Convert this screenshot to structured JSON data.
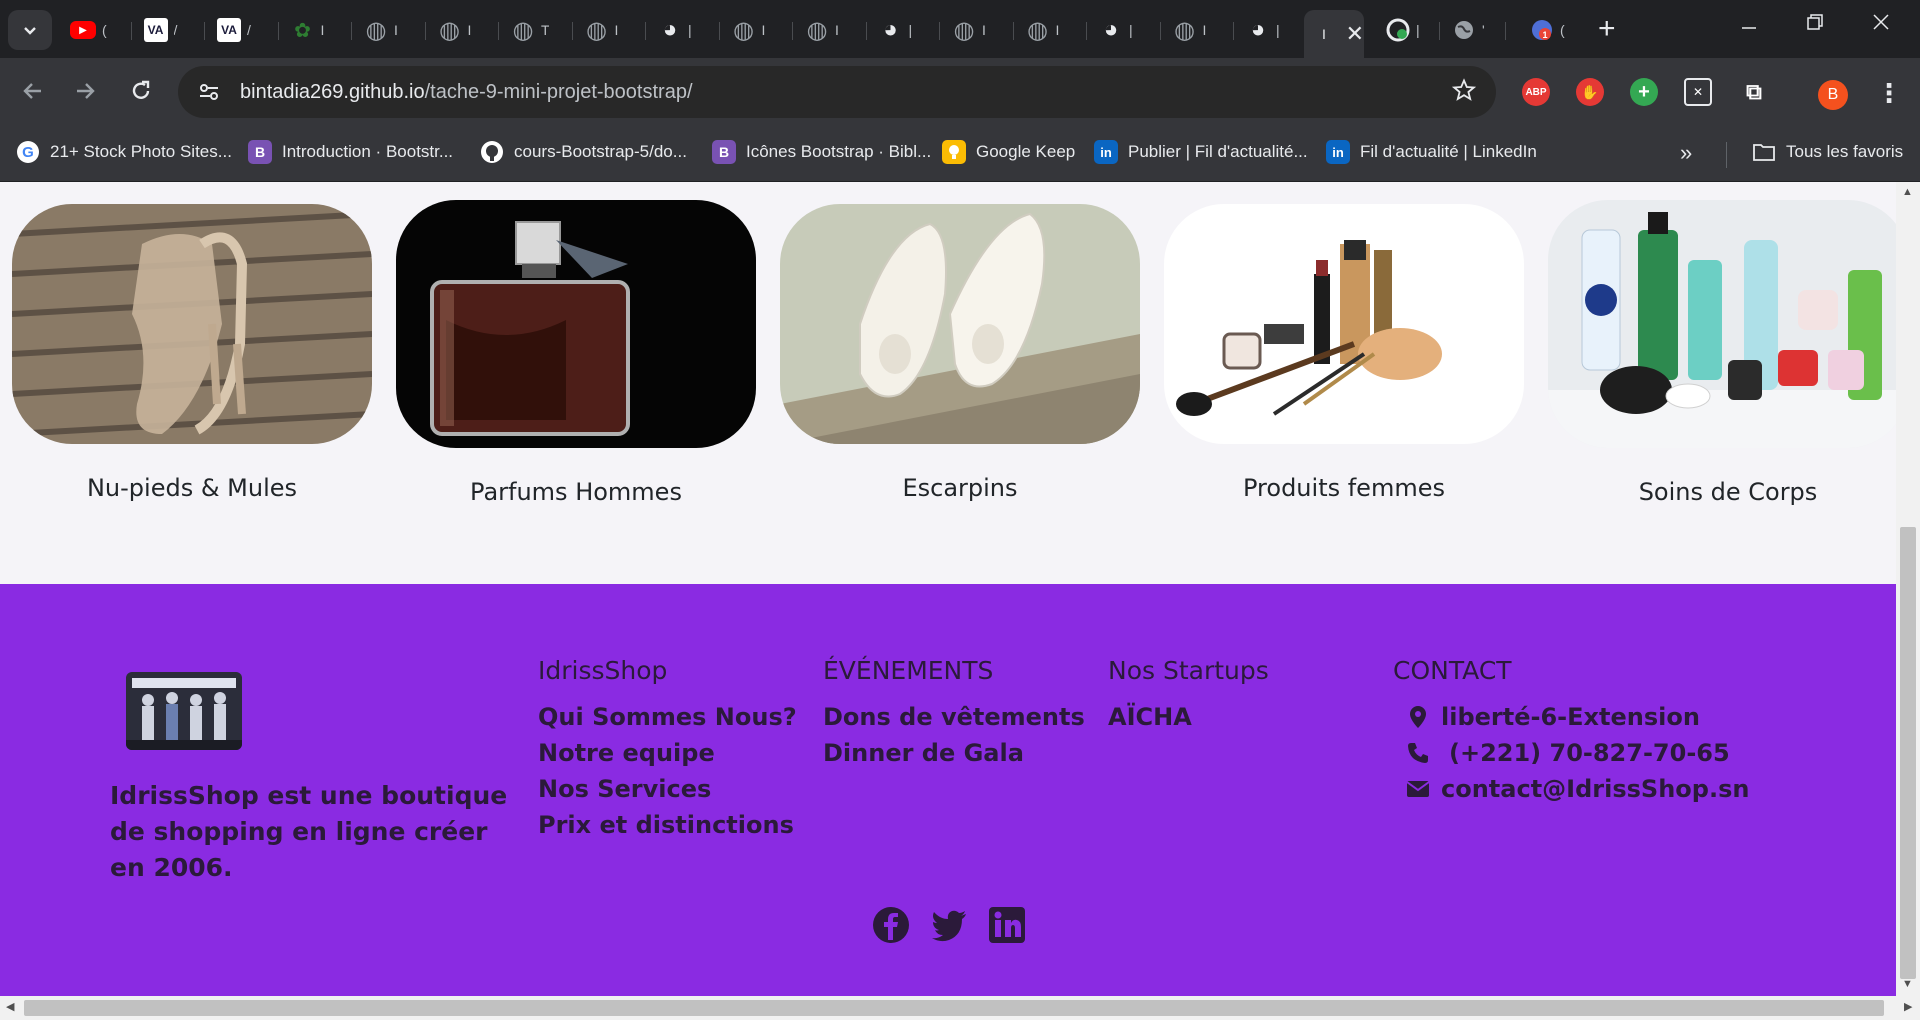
{
  "browser": {
    "active_tab_close": "✕",
    "new_tab": "+",
    "tabs": [
      {
        "icon": "youtube-icon",
        "color": "#ff0000",
        "glyph": "▶",
        "title": "("
      },
      {
        "icon": "va-icon",
        "color": "#1b1b3a",
        "glyph": "VA",
        "title": "/"
      },
      {
        "icon": "va-icon",
        "color": "#1b1b3a",
        "glyph": "VA",
        "title": "/"
      },
      {
        "icon": "leaf-icon",
        "color": "#2e7d32",
        "glyph": "✿",
        "title": "I"
      },
      {
        "icon": "globe-icon",
        "color": "#9aa0a6",
        "glyph": "◍",
        "title": "I"
      },
      {
        "icon": "globe-icon",
        "color": "#9aa0a6",
        "glyph": "◍",
        "title": "I"
      },
      {
        "icon": "globe-icon",
        "color": "#9aa0a6",
        "glyph": "◍",
        "title": "T"
      },
      {
        "icon": "globe-icon",
        "color": "#9aa0a6",
        "glyph": "◍",
        "title": "I"
      },
      {
        "icon": "github-check-icon",
        "color": "#e8eaed",
        "glyph": "◕",
        "title": "|"
      },
      {
        "icon": "globe-icon",
        "color": "#9aa0a6",
        "glyph": "◍",
        "title": "I"
      },
      {
        "icon": "globe-icon",
        "color": "#9aa0a6",
        "glyph": "◍",
        "title": "I"
      },
      {
        "icon": "github-check-icon",
        "color": "#e8eaed",
        "glyph": "◕",
        "title": "|"
      },
      {
        "icon": "globe-icon",
        "color": "#9aa0a6",
        "glyph": "◍",
        "title": "I"
      },
      {
        "icon": "globe-icon",
        "color": "#9aa0a6",
        "glyph": "◍",
        "title": "I"
      },
      {
        "icon": "github-check-icon",
        "color": "#e8eaed",
        "glyph": "◕",
        "title": "|"
      },
      {
        "icon": "globe-icon",
        "color": "#9aa0a6",
        "glyph": "◍",
        "title": "I"
      },
      {
        "icon": "github-check-icon",
        "color": "#e8eaed",
        "glyph": "◕",
        "title": "|"
      }
    ],
    "url_host": "bintadia269.github.io",
    "url_path": "/tache-9-mini-projet-bootstrap/",
    "profile_initial": "B",
    "extensions": [
      "ABP",
      "✋",
      "+",
      "✕",
      "⧉"
    ],
    "bookmarks": [
      {
        "icon": "google-icon",
        "color": "#ffffff",
        "label": "21+ Stock Photo Sites..."
      },
      {
        "icon": "bootstrap-icon",
        "color": "#7952b3",
        "label": "Introduction · Bootstr..."
      },
      {
        "icon": "github-icon",
        "color": "#ffffff",
        "label": "cours-Bootstrap-5/do..."
      },
      {
        "icon": "bootstrap-icon",
        "color": "#7952b3",
        "label": "Icônes Bootstrap · Bibl..."
      },
      {
        "icon": "keep-icon",
        "color": "#fbbc04",
        "label": "Google Keep"
      },
      {
        "icon": "linkedin-icon",
        "color": "#0a66c2",
        "label": "Publier | Fil d'actualité..."
      },
      {
        "icon": "linkedin-icon",
        "color": "#0a66c2",
        "label": "Fil d'actualité | LinkedIn"
      }
    ],
    "bookmarks_overflow": "»",
    "all_bookmarks": "Tous les favoris"
  },
  "categories": [
    {
      "label": "Nu-pieds & Mules"
    },
    {
      "label": "Parfums Hommes"
    },
    {
      "label": "Escarpins"
    },
    {
      "label": "Produits femmes"
    },
    {
      "label": "Soins de Corps"
    }
  ],
  "footer": {
    "background": "#8a2be2",
    "about": "IdrissShop est une boutique de shopping en ligne créer en 2006.",
    "col1": {
      "heading": "IdrissShop",
      "links": [
        "Qui Sommes Nous?",
        "Notre equipe",
        "Nos Services",
        "Prix et distinctions"
      ]
    },
    "col2": {
      "heading": "ÉVÉNEMENTS",
      "links": [
        "Dons de vêtements",
        "Dinner de Gala"
      ]
    },
    "col3": {
      "heading": "Nos Startups",
      "links": [
        "AÏCHA"
      ]
    },
    "contact": {
      "heading": "CONTACT",
      "address": "liberté-6-Extension",
      "phone": "(+221) 70-827-70-65",
      "email": "contact@IdrissShop.sn"
    },
    "social": [
      "facebook-icon",
      "twitter-icon",
      "linkedin-icon"
    ]
  }
}
